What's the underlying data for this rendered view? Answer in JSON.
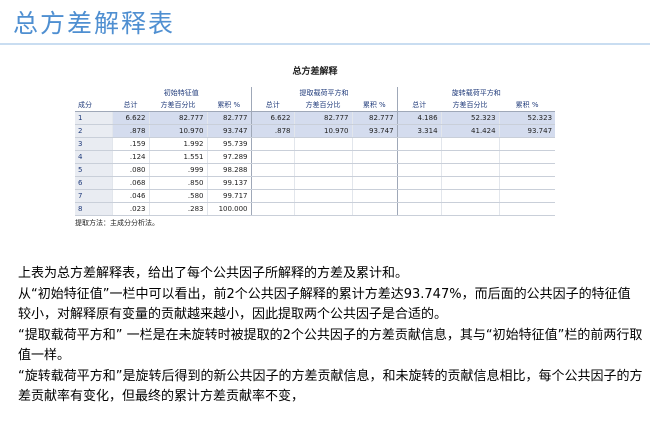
{
  "title": "总方差解释表",
  "table": {
    "caption": "总方差解释",
    "row_header": "成分",
    "groups": [
      "初始特征值",
      "提取载荷平方和",
      "旋转载荷平方和"
    ],
    "columns": [
      "总计",
      "方差百分比",
      "累积 %",
      "总计",
      "方差百分比",
      "累积 %",
      "总计",
      "方差百分比",
      "累积 %"
    ],
    "rows": [
      {
        "label": "1",
        "cells": [
          "6.622",
          "82.777",
          "82.777",
          "6.622",
          "82.777",
          "82.777",
          "4.186",
          "52.323",
          "52.323"
        ]
      },
      {
        "label": "2",
        "cells": [
          ".878",
          "10.970",
          "93.747",
          ".878",
          "10.970",
          "93.747",
          "3.314",
          "41.424",
          "93.747"
        ]
      },
      {
        "label": "3",
        "cells": [
          ".159",
          "1.992",
          "95.739",
          "",
          "",
          "",
          "",
          "",
          ""
        ]
      },
      {
        "label": "4",
        "cells": [
          ".124",
          "1.551",
          "97.289",
          "",
          "",
          "",
          "",
          "",
          ""
        ]
      },
      {
        "label": "5",
        "cells": [
          ".080",
          ".999",
          "98.288",
          "",
          "",
          "",
          "",
          "",
          ""
        ]
      },
      {
        "label": "6",
        "cells": [
          ".068",
          ".850",
          "99.137",
          "",
          "",
          "",
          "",
          "",
          ""
        ]
      },
      {
        "label": "7",
        "cells": [
          ".046",
          ".580",
          "99.717",
          "",
          "",
          "",
          "",
          "",
          ""
        ]
      },
      {
        "label": "8",
        "cells": [
          ".023",
          ".283",
          "100.000",
          "",
          "",
          "",
          "",
          "",
          ""
        ]
      }
    ],
    "footnote": "提取方法：主成分分析法。"
  },
  "paragraphs": [
    "上表为总方差解释表，给出了每个公共因子所解释的方差及累计和。",
    "从“初始特征值”一栏中可以看出，前2个公共因子解释的累计方差达93.747%，而后面的公共因子的特征值较小，对解释原有变量的贡献越来越小，因此提取两个公共因子是合适的。",
    "“提取载荷平方和” 一栏是在未旋转时被提取的2个公共因子的方差贡献信息，其与“初始特征值”栏的前两行取值一样。",
    "“旋转载荷平方和”是旋转后得到的新公共因子的方差贡献信息，和未旋转的贡献信息相比，每个公共因子的方差贡献率有变化，但最终的累计方差贡献率不变，"
  ]
}
